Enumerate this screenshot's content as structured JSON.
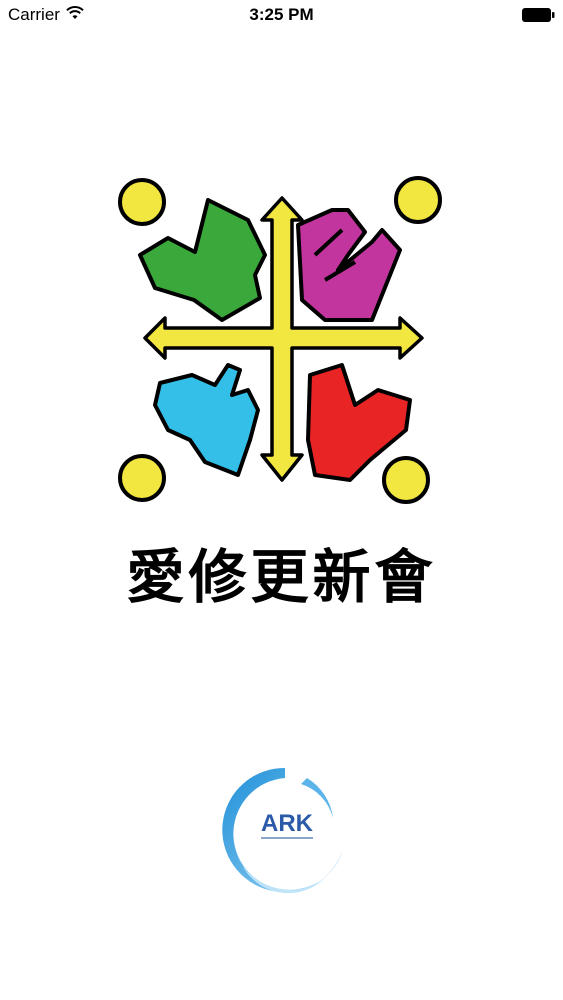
{
  "status_bar": {
    "carrier": "Carrier",
    "time": "3:25 PM",
    "wifi_icon": "wifi-icon",
    "battery_icon": "battery-icon"
  },
  "splash": {
    "org_name": "愛修更新會",
    "logo_icon": "organization-logo-icon",
    "ark_logo": {
      "text": "ARK",
      "icon": "ark-logo-icon"
    }
  },
  "colors": {
    "green": "#3aa83a",
    "magenta": "#c2349e",
    "blue": "#34bfe8",
    "red": "#e82424",
    "yellow": "#f2e640",
    "ark_blue": "#2b5aa8"
  }
}
